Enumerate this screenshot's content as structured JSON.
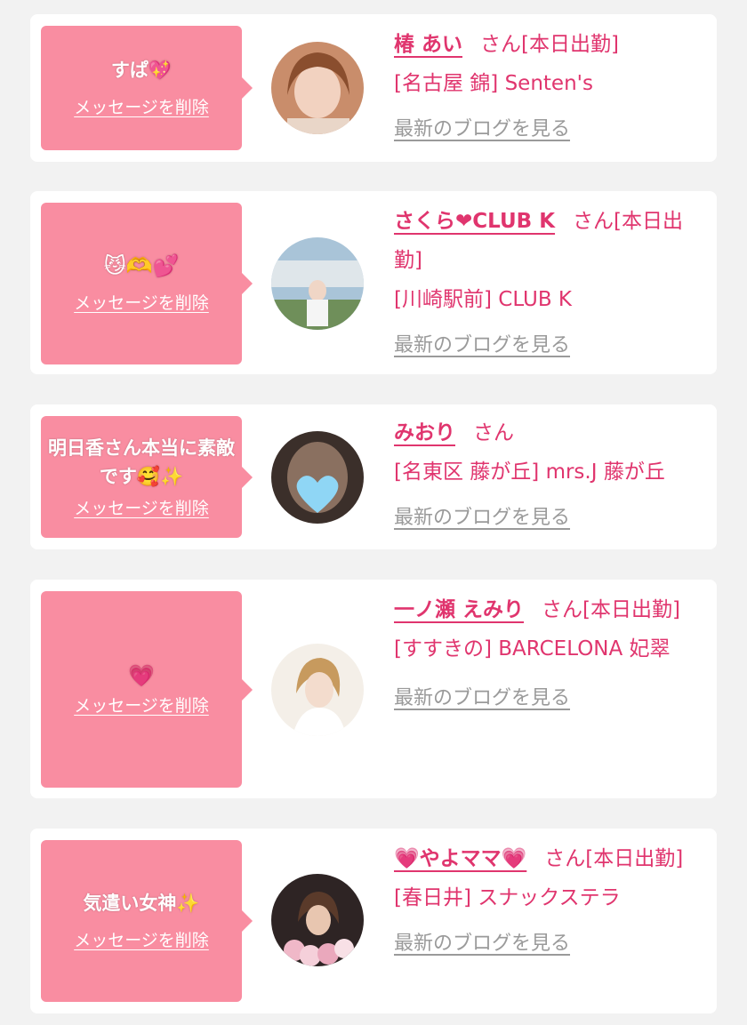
{
  "delete_label": "メッセージを削除",
  "blog_label": "最新のブログを見る",
  "cards": [
    {
      "message": "すぱ💖",
      "name": "椿 あい",
      "suffix": "さん[本日出勤]",
      "shop": "[名古屋 錦] Senten's"
    },
    {
      "message": "😼🫶💕",
      "name": "さくら❤CLUB K",
      "suffix": "さん[本日出勤]",
      "shop": "[川崎駅前] CLUB K"
    },
    {
      "message": "明日香さん本当に素敵です🥰✨",
      "name": "みおり",
      "suffix": "さん",
      "shop": "[名東区 藤が丘] mrs.J 藤が丘"
    },
    {
      "message": "💗",
      "name": "一ノ瀬 えみり",
      "suffix": "さん[本日出勤]",
      "shop": "[すすきの] BARCELONA 妃翠"
    },
    {
      "message": "気遣い女神✨",
      "name": "💗やよママ💗",
      "suffix": "さん[本日出勤]",
      "shop": "[春日井] スナックステラ"
    }
  ],
  "colors": {
    "accent": "#e0356e",
    "bubble": "#f98da1",
    "link_gray": "#9a9a9a",
    "background": "#f2f2f2"
  }
}
